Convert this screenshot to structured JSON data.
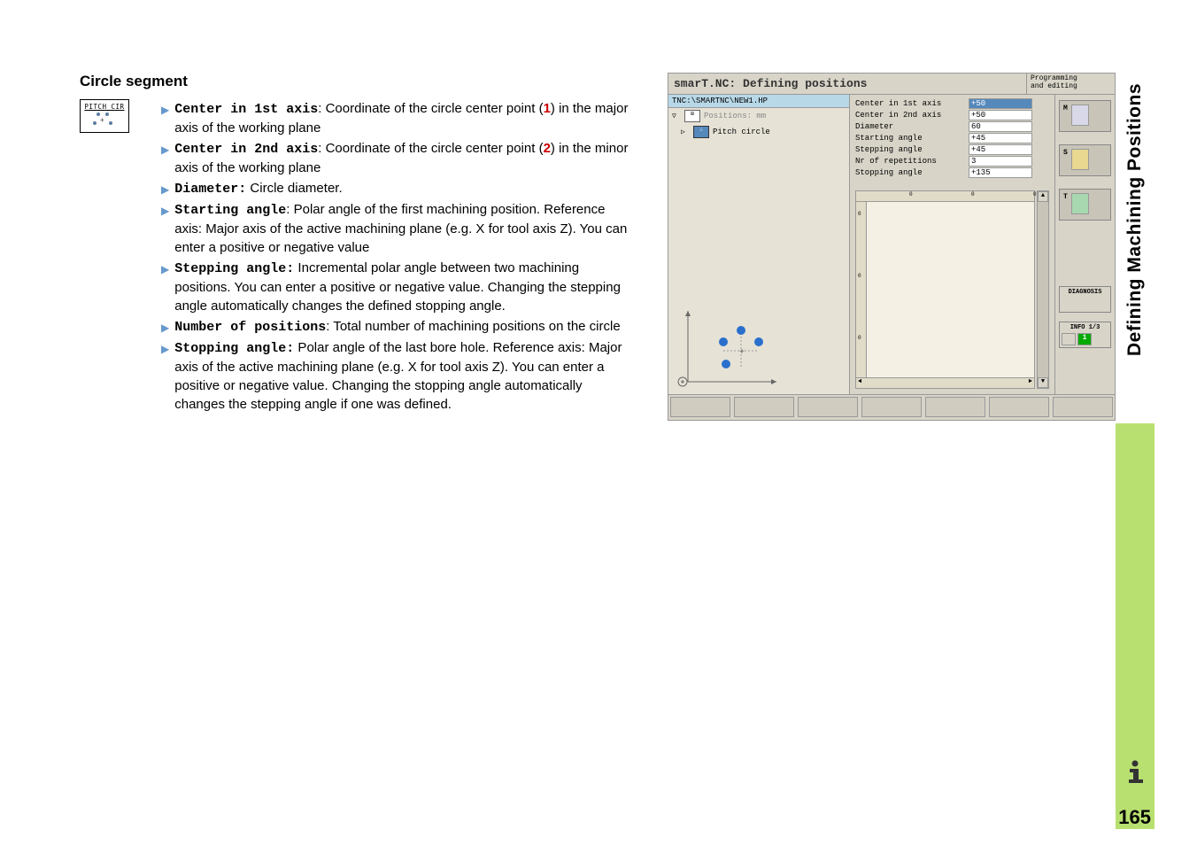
{
  "section_title": "Circle segment",
  "icon_label": "PITCH CIR",
  "bullets": [
    {
      "bold": "Center in 1st axis",
      "after_bold": ": Coordinate of the circle center point (",
      "ref": "1",
      "ref_class": "ref-1",
      "rest": ") in the major axis of the working plane"
    },
    {
      "bold": "Center in 2nd axis",
      "after_bold": ": Coordinate of the circle center point (",
      "ref": "2",
      "ref_class": "ref-2",
      "rest": ") in the minor axis of the working plane"
    },
    {
      "bold": "Diameter:",
      "after_bold": " Circle diameter.",
      "ref": "",
      "ref_class": "",
      "rest": ""
    },
    {
      "bold": "Starting angle",
      "after_bold": ": Polar angle of the first machining position. Reference axis: Major axis of the active machining plane (e.g. X for tool axis Z). You can enter a positive or negative value",
      "ref": "",
      "ref_class": "",
      "rest": ""
    },
    {
      "bold": "Stepping angle:",
      "after_bold": " Incremental polar angle between two machining positions. You can enter a positive or negative value. Changing the stepping angle automatically changes the defined stopping angle.",
      "ref": "",
      "ref_class": "",
      "rest": ""
    },
    {
      "bold": "Number of positions",
      "after_bold": ": Total number of machining positions on the circle",
      "ref": "",
      "ref_class": "",
      "rest": ""
    },
    {
      "bold": "Stopping angle:",
      "after_bold": " Polar angle of the last bore hole. Reference axis: Major axis of the active machining plane (e.g. X for tool axis Z). You can enter a positive or negative value. Changing the stopping angle automatically changes the stepping angle if one was defined.",
      "ref": "",
      "ref_class": "",
      "rest": ""
    }
  ],
  "screenshot": {
    "title": "smarT.NC: Defining positions",
    "mode_line1": "Programming",
    "mode_line2": "and editing",
    "path": "TNC:\\SMARTNC\\NEW1.HP",
    "tree": [
      {
        "arrow": "▽",
        "icon": "⊞",
        "label": "Positions: mm",
        "selected": false
      },
      {
        "arrow": "▷",
        "icon": "∴",
        "label": "Pitch circle",
        "selected": true
      }
    ],
    "params": [
      {
        "label": "Center in 1st axis",
        "value": "+50",
        "active": true
      },
      {
        "label": "Center in 2nd axis",
        "value": "+50",
        "active": false
      },
      {
        "label": "Diameter",
        "value": "60",
        "active": false
      },
      {
        "label": "Starting angle",
        "value": "+45",
        "active": false
      },
      {
        "label": "Stepping angle",
        "value": "+45",
        "active": false
      },
      {
        "label": "Nr of repetitions",
        "value": "3",
        "active": false
      },
      {
        "label": "Stopping angle",
        "value": "+135",
        "active": false
      }
    ],
    "side_buttons": [
      "M",
      "S",
      "T"
    ],
    "diagnosis": "DIAGNOSIS",
    "info": "INFO 1/3",
    "info_num": "1"
  },
  "vertical_text": "Defining Machining Positions",
  "page_number": "165"
}
